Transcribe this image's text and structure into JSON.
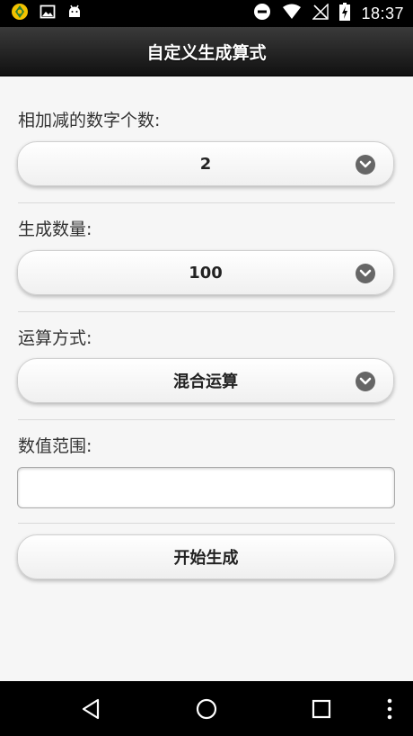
{
  "status_bar": {
    "time": "18:37",
    "left_icons": [
      "app-notification-icon",
      "image-icon",
      "android-icon"
    ],
    "right_icons": [
      "do-not-disturb-icon",
      "wifi-icon",
      "no-signal-icon",
      "battery-charging-icon"
    ]
  },
  "header": {
    "title": "自定义生成算式"
  },
  "form": {
    "digits": {
      "label": "相加减的数字个数:",
      "value": "2"
    },
    "quantity": {
      "label": "生成数量:",
      "value": "100"
    },
    "operation": {
      "label": "运算方式:",
      "value": "混合运算"
    },
    "range": {
      "label": "数值范围:",
      "value": "",
      "placeholder": ""
    },
    "start_button_label": "开始生成"
  },
  "nav_bar": {
    "buttons": [
      "back-icon",
      "home-icon",
      "recents-icon",
      "overflow-menu-icon"
    ]
  },
  "colors": {
    "header_bg": "#1f1f1f",
    "content_bg": "#f6f6f6",
    "chevron_badge": "#666666",
    "status_bar_bg": "#000000"
  }
}
